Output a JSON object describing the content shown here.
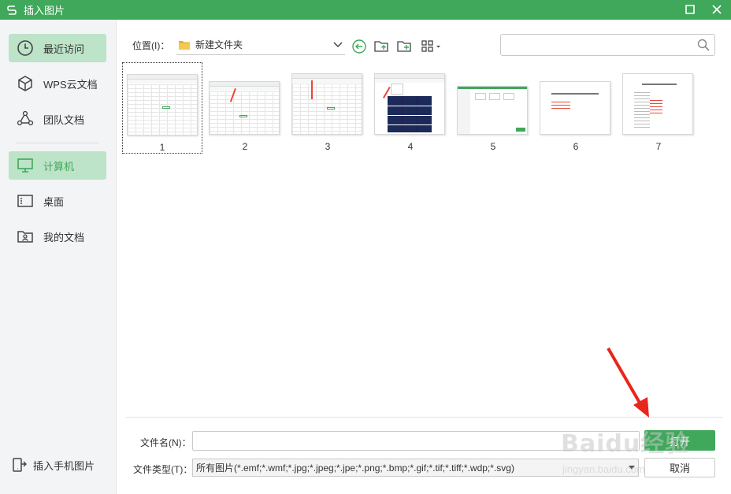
{
  "window": {
    "title": "插入图片",
    "accent": "#3fa85a"
  },
  "sidebar": {
    "items": [
      {
        "label": "最近访问",
        "icon": "clock-icon",
        "active": true
      },
      {
        "label": "WPS云文档",
        "icon": "cube-icon",
        "active": false
      },
      {
        "label": "团队文档",
        "icon": "team-icon",
        "active": false
      },
      {
        "label": "计算机",
        "icon": "monitor-icon",
        "active": true
      },
      {
        "label": "桌面",
        "icon": "desktop-icon",
        "active": false
      },
      {
        "label": "我的文档",
        "icon": "my-documents-icon",
        "active": false
      }
    ],
    "bottom_label": "插入手机图片"
  },
  "location": {
    "label": "位置(I)：",
    "value": "新建文件夹"
  },
  "search": {
    "placeholder": ""
  },
  "thumbnails": [
    {
      "caption": "1",
      "selected": true
    },
    {
      "caption": "2",
      "selected": false
    },
    {
      "caption": "3",
      "selected": false
    },
    {
      "caption": "4",
      "selected": false
    },
    {
      "caption": "5",
      "selected": false
    },
    {
      "caption": "6",
      "selected": false
    },
    {
      "caption": "7",
      "selected": false
    }
  ],
  "footer": {
    "filename_label": "文件名(N)：",
    "filename_value": "",
    "filetype_label": "文件类型(T)：",
    "filetype_value": "所有图片(*.emf;*.wmf;*.jpg;*.jpeg;*.jpe;*.png;*.bmp;*.gif;*.tif;*.tiff;*.wdp;*.svg)",
    "open_button": "打开",
    "cancel_button": "取消"
  },
  "watermark": {
    "text": "Baidu经验",
    "sub": "jingyan.baidu.com"
  }
}
